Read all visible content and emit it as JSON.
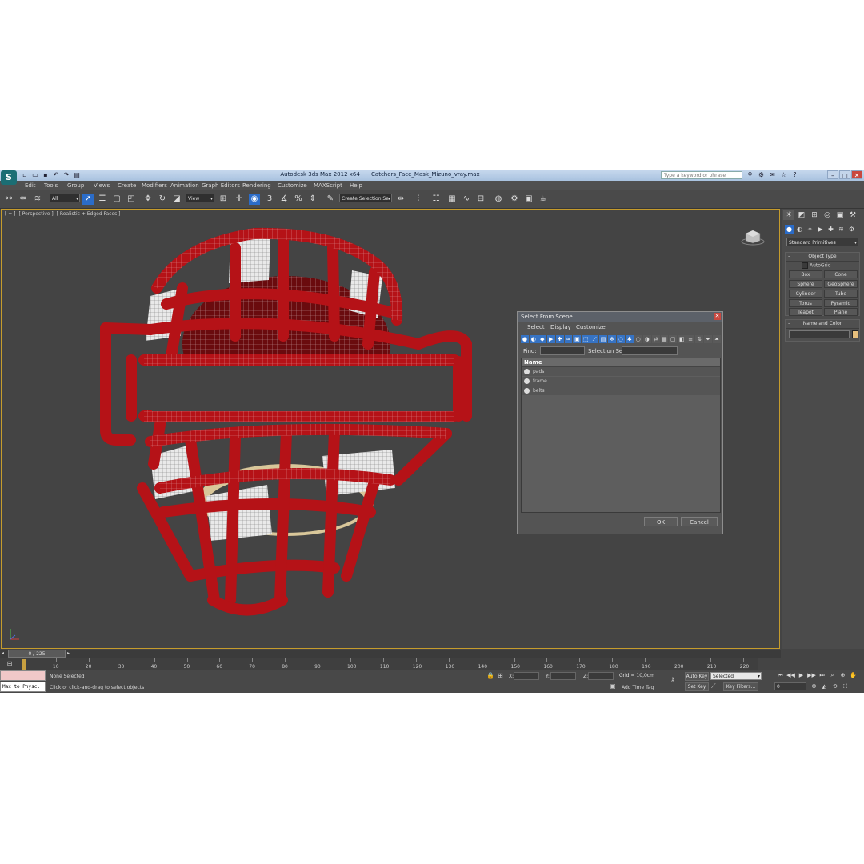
{
  "app": {
    "title": "Autodesk 3ds Max  2012 x64",
    "file": "Catchers_Face_Mask_Mizuno_vray.max",
    "search_placeholder": "Type a keyword or phrase",
    "logo_glyph": "S"
  },
  "menubar": [
    "Edit",
    "Tools",
    "Group",
    "Views",
    "Create",
    "Modifiers",
    "Animation",
    "Graph Editors",
    "Rendering",
    "Customize",
    "MAXScript",
    "Help"
  ],
  "toolbar": {
    "filter_value": "All",
    "refcoord_value": "View",
    "selection_set_placeholder": "Create Selection Se",
    "snap_label": "3",
    "angle_snap_label": "%"
  },
  "viewport": {
    "label_parts": [
      "[ + ]",
      "[ Perspective ]",
      "[ Realistic + Edged Faces ]"
    ],
    "mask_color": "#b51217",
    "pad_color": "#e9e9e9"
  },
  "dialog": {
    "title": "Select From Scene",
    "menu": [
      "Select",
      "Display",
      "Customize"
    ],
    "find_label": "Find:",
    "selection_set_label": "Selection Set:",
    "column_name": "Name",
    "items": [
      "pads",
      "frame",
      "belts"
    ],
    "ok_label": "OK",
    "cancel_label": "Cancel"
  },
  "command_panel": {
    "dropdown_value": "Standard Primitives",
    "object_type_title": "Object Type",
    "autogrid_label": "AutoGrid",
    "primitives": [
      "Box",
      "Cone",
      "Sphere",
      "GeoSphere",
      "Cylinder",
      "Tube",
      "Torus",
      "Pyramid",
      "Teapot",
      "Plane"
    ],
    "name_color_title": "Name and Color",
    "swatch_color": "#e8c07d"
  },
  "timeline": {
    "frame_indicator": "0 / 225",
    "ticks": [
      "10",
      "20",
      "30",
      "40",
      "50",
      "60",
      "70",
      "80",
      "90",
      "100",
      "110",
      "120",
      "130",
      "140",
      "150",
      "160",
      "170",
      "180",
      "190",
      "200",
      "210",
      "220"
    ]
  },
  "status": {
    "listener_text": "Max to Physc.",
    "selection": "None Selected",
    "prompt": "Click or click-and-drag to select objects",
    "x_label": "X:",
    "y_label": "Y:",
    "z_label": "Z:",
    "grid": "Grid = 10,0cm",
    "add_time_tag": "Add Time Tag",
    "auto_key": "Auto Key",
    "set_key": "Set Key",
    "key_mode_value": "Selected",
    "key_filters": "Key Filters...",
    "frame_value": "0"
  }
}
